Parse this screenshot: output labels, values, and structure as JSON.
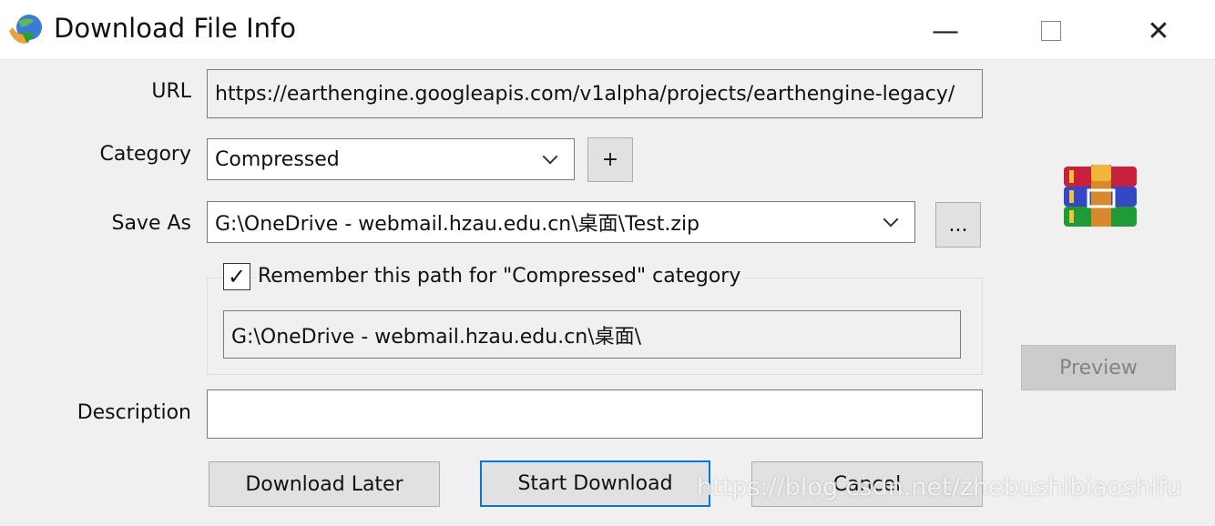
{
  "window": {
    "title": "Download File Info",
    "icon": "idm-globe-icon"
  },
  "controls": {
    "minimize": "—",
    "maximize": "☐",
    "close": "✕"
  },
  "form": {
    "url_label": "URL",
    "url_value": "https://earthengine.googleapis.com/v1alpha/projects/earthengine-legacy/",
    "category_label": "Category",
    "category_value": "Compressed",
    "add_category": "+",
    "saveas_label": "Save As",
    "saveas_value": "G:\\OneDrive - webmail.hzau.edu.cn\\桌面\\Test.zip",
    "browse": "...",
    "remember_label": "Remember this path for \"Compressed\" category",
    "remember_checked": true,
    "remember_path": "G:\\OneDrive - webmail.hzau.edu.cn\\桌面\\",
    "description_label": "Description",
    "description_value": ""
  },
  "file_icon": "winrar-archive-icon",
  "buttons": {
    "preview": "Preview",
    "download_later": "Download Later",
    "start_download": "Start Download",
    "cancel": "Cancel"
  },
  "watermark": "https://blog.csdn.net/zhebushibiaoshifu"
}
